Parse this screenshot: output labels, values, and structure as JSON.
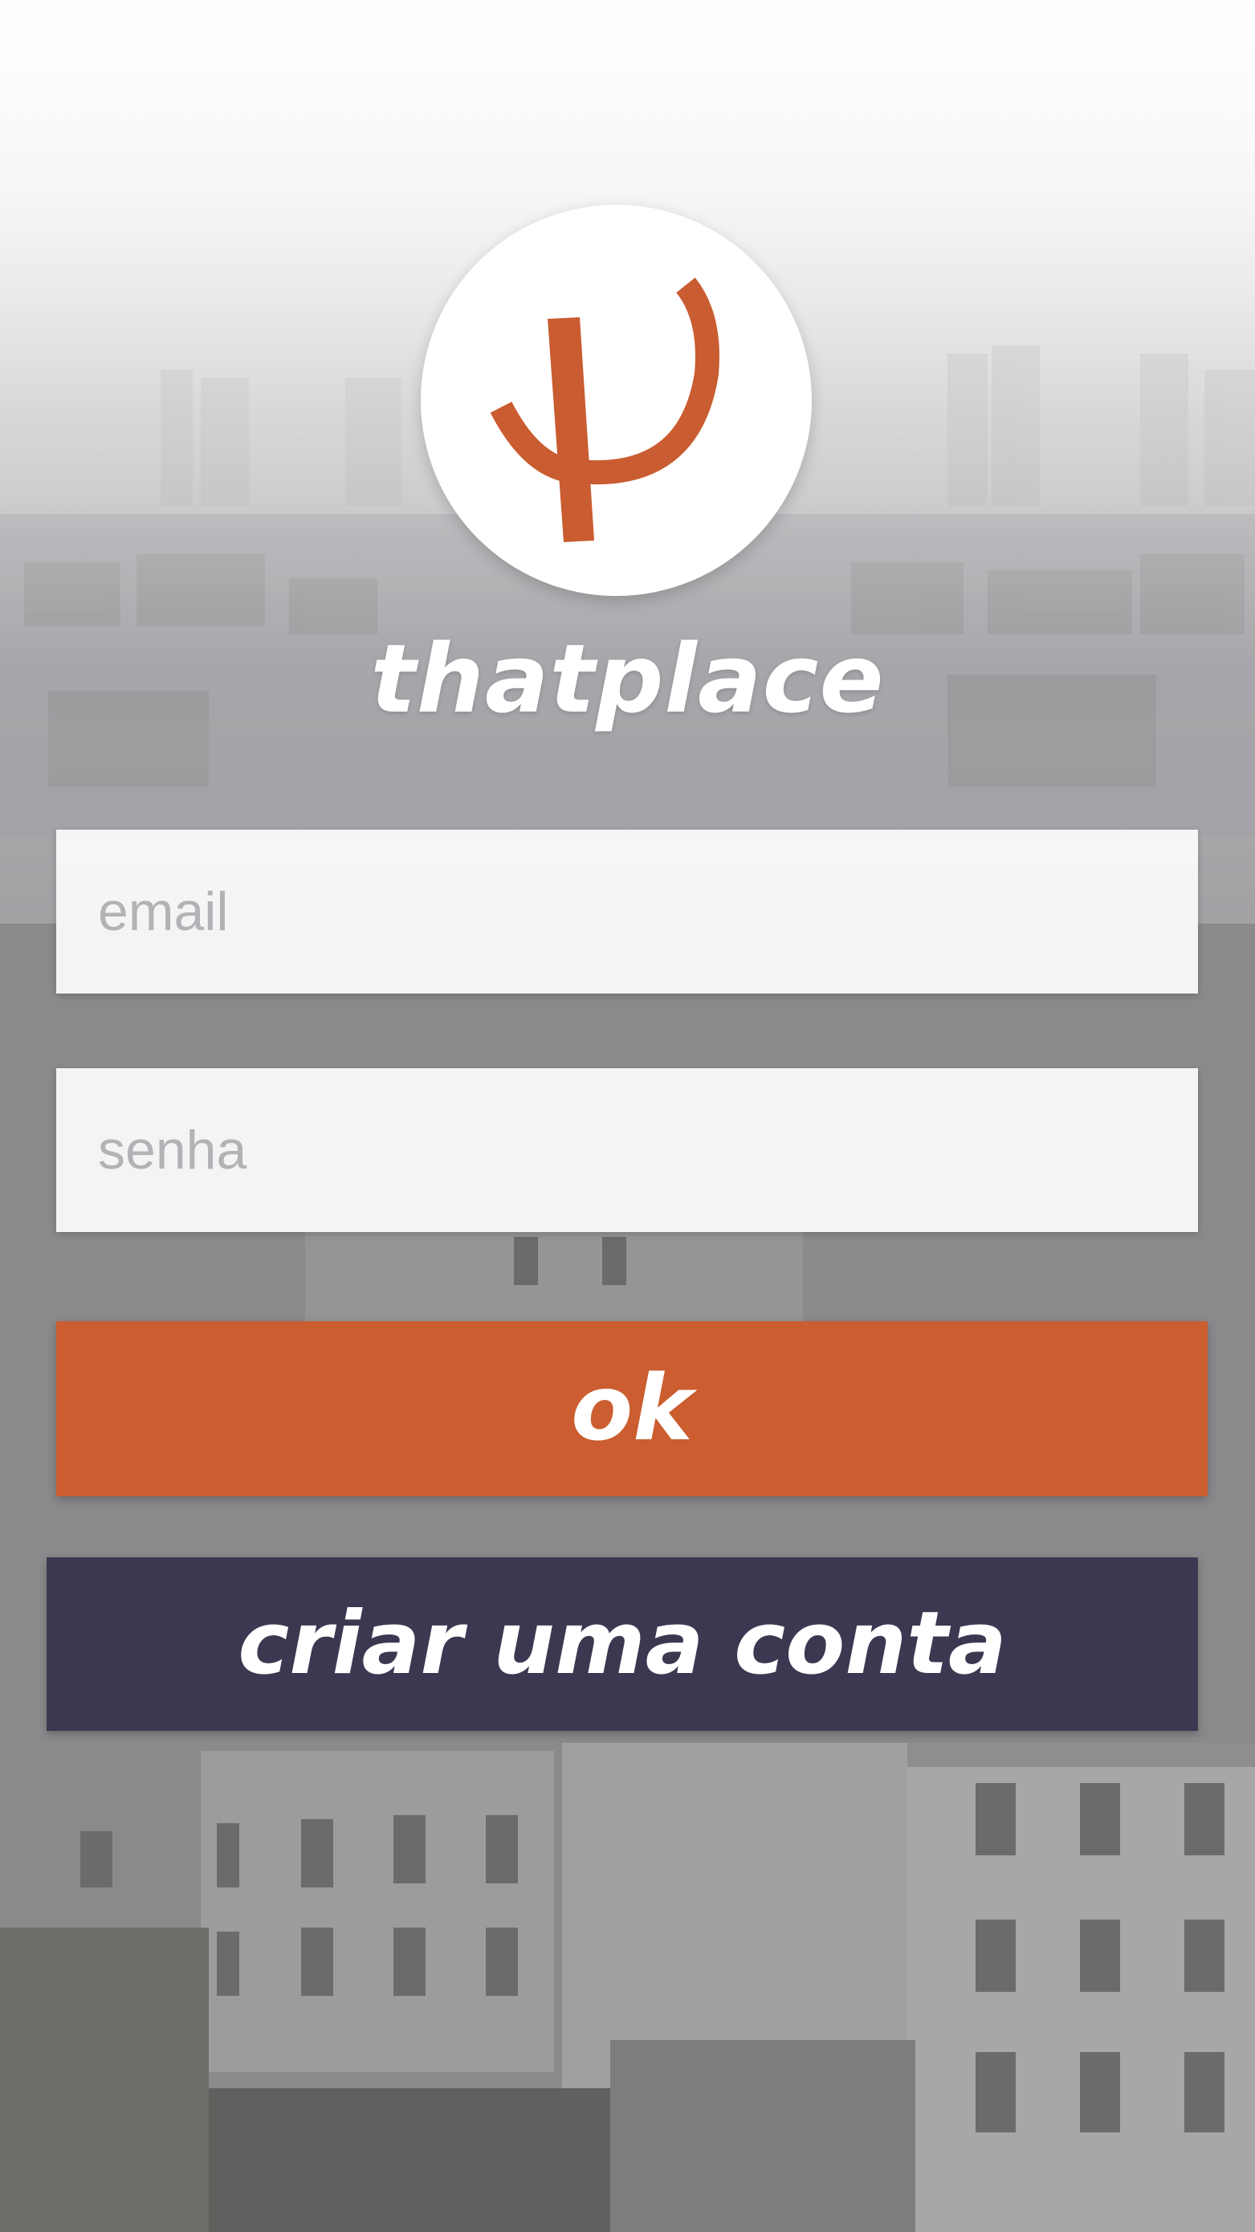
{
  "app": {
    "brand_name": "thatplace",
    "logo_icon": "thatplace-psi-logo-icon",
    "accent_color": "#cb5d30",
    "secondary_color": "#3e3751"
  },
  "login_form": {
    "email_placeholder": "email",
    "email_value": "",
    "password_placeholder": "senha",
    "password_value": "",
    "submit_label": "ok",
    "create_account_label": "criar uma conta"
  }
}
